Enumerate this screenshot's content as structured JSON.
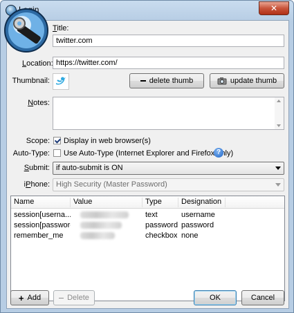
{
  "window": {
    "title": "Login",
    "close_glyph": "✕"
  },
  "form": {
    "title_label": "Title:",
    "title_value": "twitter.com",
    "location_label": "Location:",
    "location_value": "https://twitter.com/",
    "thumbnail_label": "Thumbnail:",
    "delete_thumb_label": "delete thumb",
    "update_thumb_label": "update thumb",
    "notes_label": "Notes:",
    "notes_value": "",
    "scope_label": "Scope:",
    "scope_checkbox_label": "Display in web browser(s)",
    "scope_checked": true,
    "autotype_label": "Auto-Type:",
    "autotype_checkbox_label": "Use Auto-Type (Internet Explorer and Firefox only)",
    "autotype_checked": false,
    "help_glyph": "?",
    "submit_label": "Submit:",
    "submit_value": "if auto-submit is ON",
    "iphone_label": "iPhone:",
    "iphone_value": "High Security (Master Password)"
  },
  "fields_table": {
    "columns": [
      "Name",
      "Value",
      "Type",
      "Designation"
    ],
    "rows": [
      {
        "name": "session[userna...",
        "value": "",
        "type": "text",
        "designation": "username"
      },
      {
        "name": "session[password]",
        "value": "",
        "type": "password",
        "designation": "password"
      },
      {
        "name": "remember_me",
        "value": "",
        "type": "checkbox",
        "designation": "none"
      }
    ]
  },
  "footer": {
    "add_label": "Add",
    "delete_label": "Delete",
    "ok_label": "OK",
    "cancel_label": "Cancel"
  },
  "colors": {
    "twitter_blue": "#2fa9e0",
    "help_blue": "#1f66c9",
    "title_bar": "#b7cde4"
  },
  "icons": [
    "app-key-icon",
    "twitter-bird-icon",
    "minus-icon",
    "camera-icon",
    "help-icon",
    "plus-icon",
    "close-icon"
  ]
}
